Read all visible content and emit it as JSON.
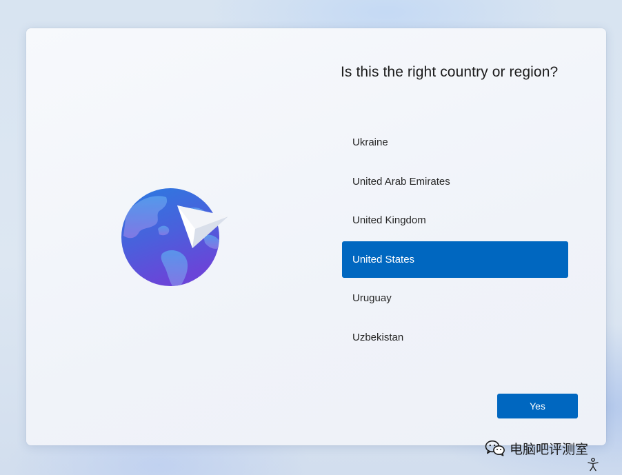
{
  "window": {
    "title": "Is this the right country or region?"
  },
  "countries": [
    {
      "label": "Ukraine",
      "selected": false
    },
    {
      "label": "United Arab Emirates",
      "selected": false
    },
    {
      "label": "United Kingdom",
      "selected": false
    },
    {
      "label": "United States",
      "selected": true
    },
    {
      "label": "Uruguay",
      "selected": false
    },
    {
      "label": "Uzbekistan",
      "selected": false
    }
  ],
  "actions": {
    "yes_label": "Yes"
  },
  "watermark": {
    "text": "电脑吧评测室"
  },
  "icons": {
    "illustration": "globe-paper-plane-icon",
    "watermark": "wechat-icon",
    "accessibility": "accessibility-icon"
  },
  "colors": {
    "accent": "#0067c0",
    "selected_text": "#ffffff",
    "card_background": "#f3f6fb"
  }
}
